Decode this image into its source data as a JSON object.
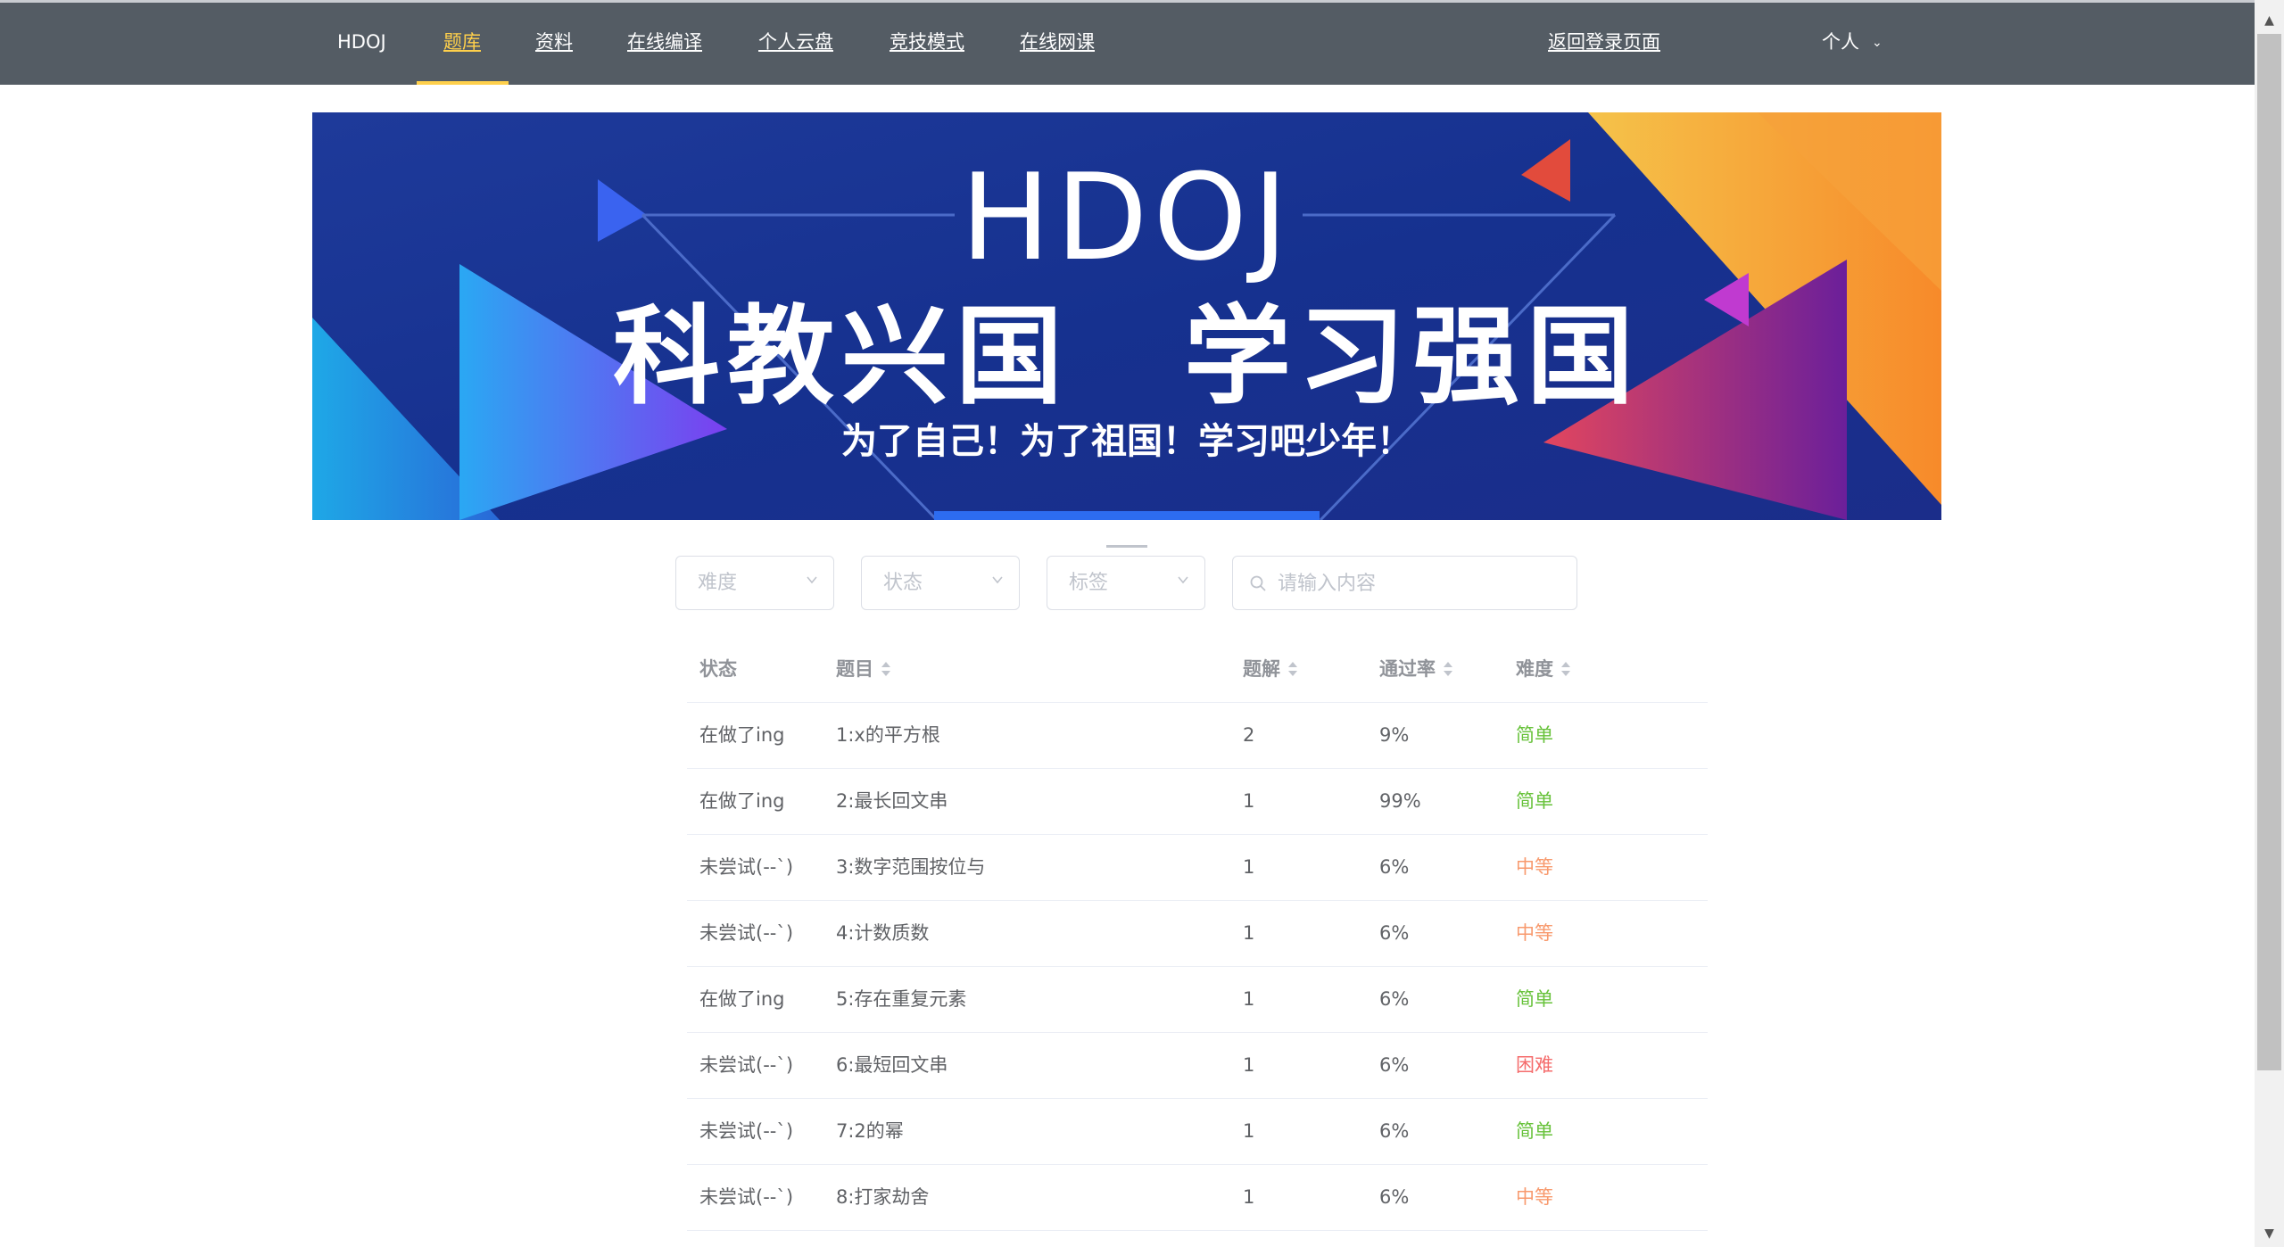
{
  "nav": {
    "brand": "HDOJ",
    "items": [
      "题库",
      "资料",
      "在线编译",
      "个人云盘",
      "竞技模式",
      "在线网课"
    ],
    "back_login": "返回登录页面",
    "personal": "个人",
    "active_color": "#ffd04b",
    "background": "#545c64"
  },
  "banner": {
    "title": "HDOJ",
    "slogan": "科教兴国　学习强国",
    "subtitle": "为了自己！为了祖国！学习吧少年！"
  },
  "filters": {
    "difficulty_placeholder": "难度",
    "status_placeholder": "状态",
    "tag_placeholder": "标签",
    "search_placeholder": "请输入内容"
  },
  "table": {
    "headers": [
      "状态",
      "题目",
      "题解",
      "通过率",
      "难度"
    ],
    "rows": [
      {
        "status": "在做了ing",
        "title": "1:x的平方根",
        "solutions": "2",
        "pass_rate": "9%",
        "difficulty": "简单",
        "level": "easy"
      },
      {
        "status": "在做了ing",
        "title": "2:最长回文串",
        "solutions": "1",
        "pass_rate": "99%",
        "difficulty": "简单",
        "level": "easy"
      },
      {
        "status": "未尝试(--`)",
        "title": "3:数字范围按位与",
        "solutions": "1",
        "pass_rate": "6%",
        "difficulty": "中等",
        "level": "medium"
      },
      {
        "status": "未尝试(--`)",
        "title": "4:计数质数",
        "solutions": "1",
        "pass_rate": "6%",
        "difficulty": "中等",
        "level": "medium"
      },
      {
        "status": "在做了ing",
        "title": "5:存在重复元素",
        "solutions": "1",
        "pass_rate": "6%",
        "difficulty": "简单",
        "level": "easy"
      },
      {
        "status": "未尝试(--`)",
        "title": "6:最短回文串",
        "solutions": "1",
        "pass_rate": "6%",
        "difficulty": "困难",
        "level": "hard"
      },
      {
        "status": "未尝试(--`)",
        "title": "7:2的幂",
        "solutions": "1",
        "pass_rate": "6%",
        "difficulty": "简单",
        "level": "easy"
      },
      {
        "status": "未尝试(--`)",
        "title": "8:打家劫舍",
        "solutions": "1",
        "pass_rate": "6%",
        "difficulty": "中等",
        "level": "medium"
      }
    ]
  },
  "colors": {
    "easy": "#67c23a",
    "medium": "#f89a6e",
    "hard": "#f56c6c"
  }
}
